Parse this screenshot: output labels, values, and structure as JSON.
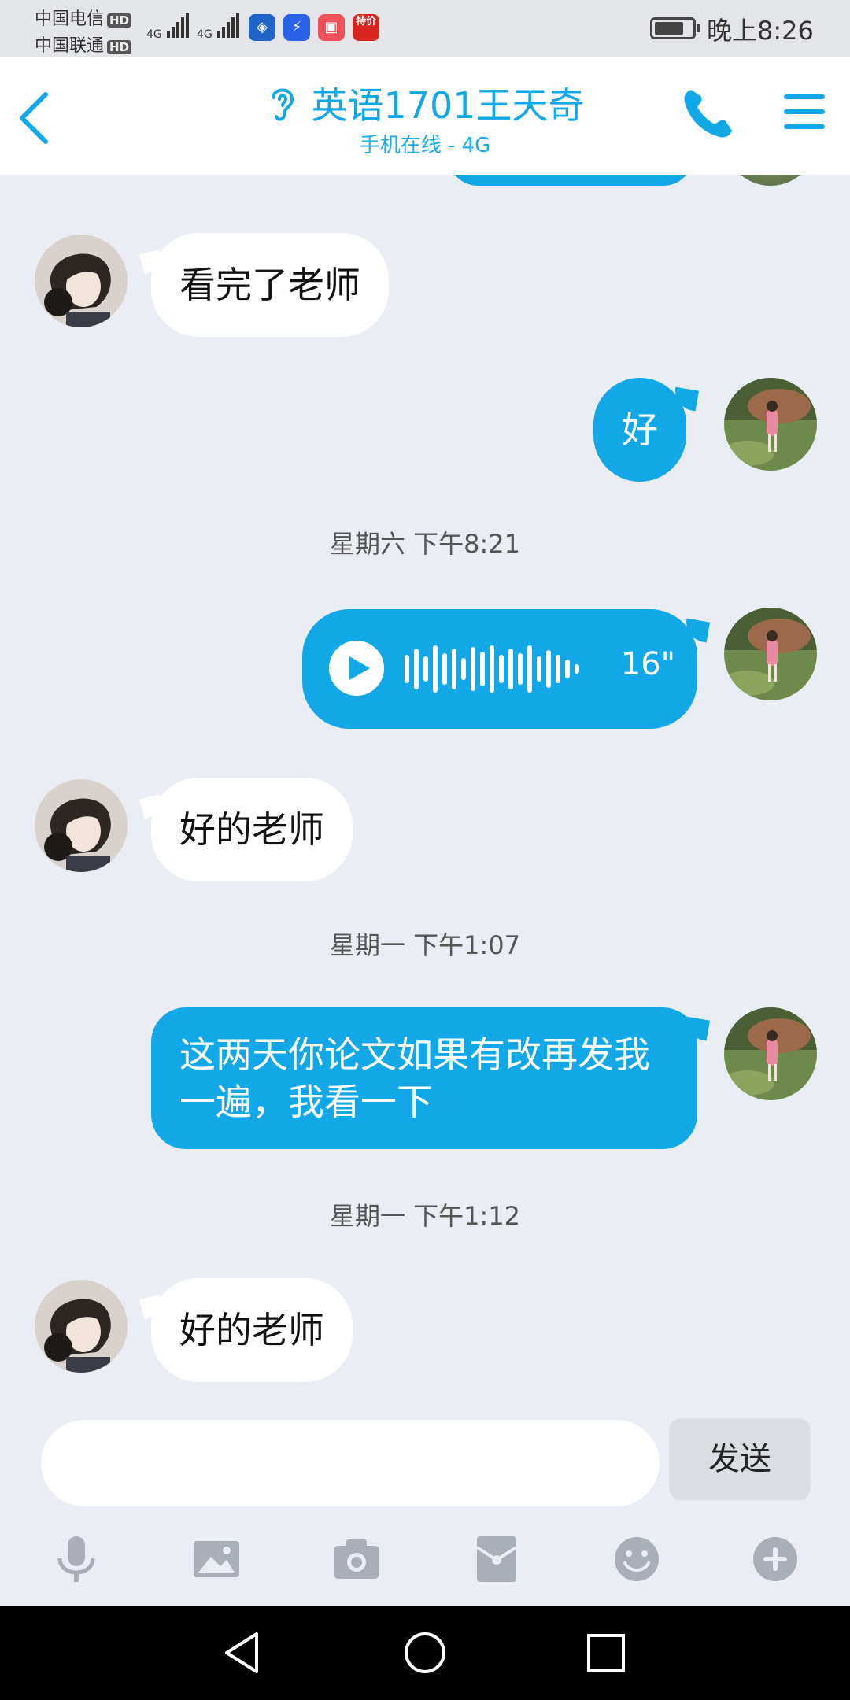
{
  "status_bar": {
    "carrier1": "中国电信",
    "carrier2": "中国联通",
    "hd": "HD",
    "net": "4G",
    "special_app": "特价",
    "time": "晚上8:26"
  },
  "header": {
    "title": "英语1701王天奇",
    "subtitle": "手机在线 - 4G"
  },
  "messages": [
    {
      "side": "in",
      "text": "看完了老师"
    },
    {
      "side": "out",
      "text": "好"
    },
    {
      "timestamp": "星期六 下午8:21"
    },
    {
      "side": "out",
      "type": "voice",
      "duration": "16\""
    },
    {
      "side": "in",
      "text": "好的老师"
    },
    {
      "timestamp": "星期一 下午1:07"
    },
    {
      "side": "out",
      "text": "这两天你论文如果有改再发我一遍，我看一下"
    },
    {
      "timestamp": "星期一 下午1:12"
    },
    {
      "side": "in",
      "text": "好的老师"
    }
  ],
  "input": {
    "placeholder": "",
    "send_label": "发送"
  },
  "toolbar": [
    "microphone-icon",
    "image-icon",
    "camera-icon",
    "red-packet-icon",
    "emoji-icon",
    "plus-icon"
  ],
  "colors": {
    "accent": "#12a8e8",
    "chat_bg": "#eaedf3",
    "incoming_bubble": "#ffffff"
  }
}
